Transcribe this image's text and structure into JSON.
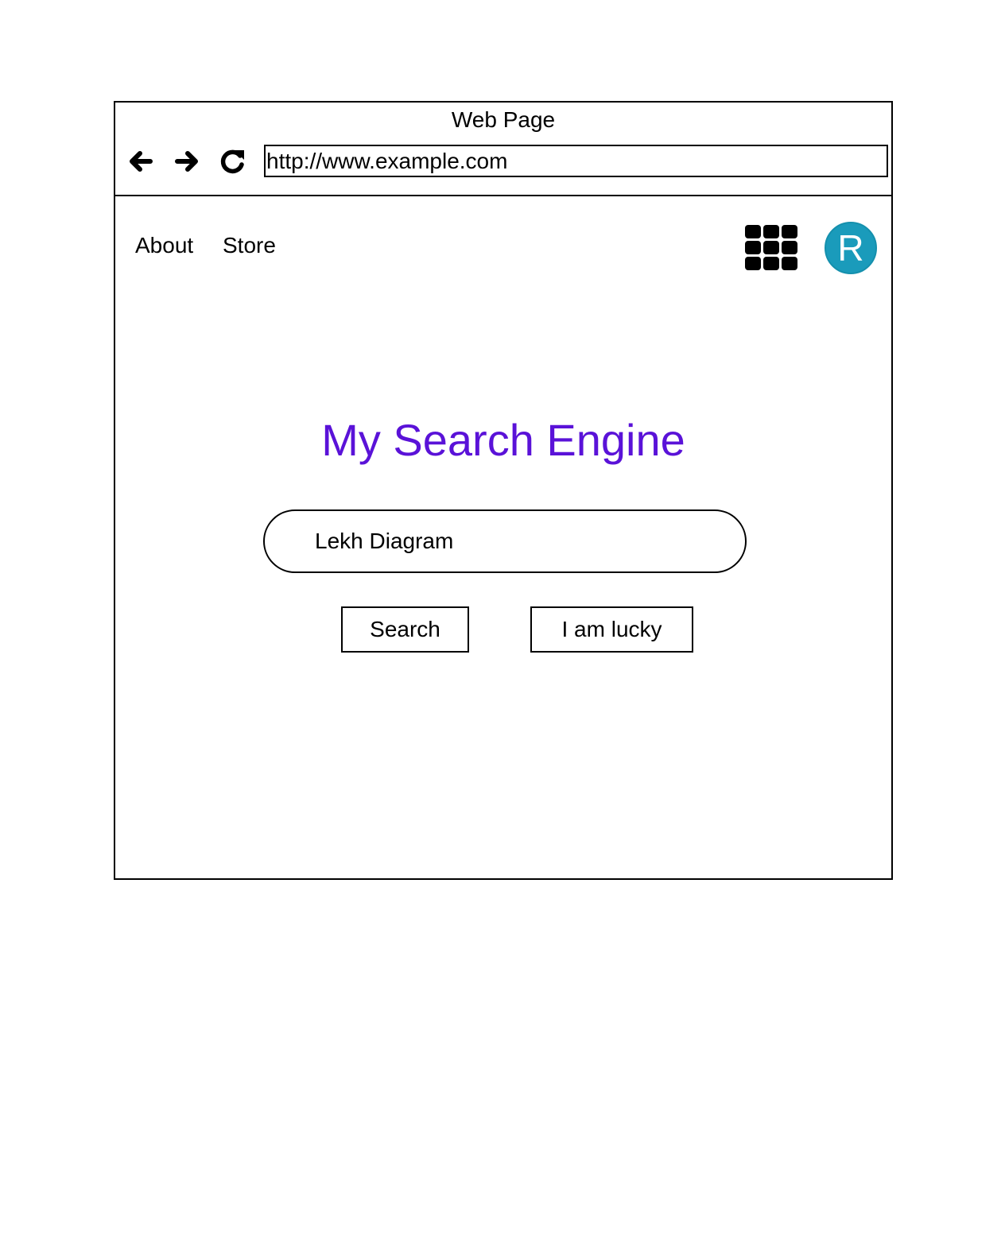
{
  "window": {
    "title": "Web Page",
    "url": "http://www.example.com"
  },
  "toolbar": {
    "back_icon": "arrow-left-icon",
    "forward_icon": "arrow-right-icon",
    "reload_icon": "reload-icon"
  },
  "nav": {
    "links": [
      {
        "label": "About"
      },
      {
        "label": "Store"
      }
    ],
    "apps_icon": "grid-icon",
    "avatar_letter": "R",
    "avatar_color": "#1a9bbb"
  },
  "main": {
    "brand": "My Search Engine",
    "brand_color": "#5a12d8",
    "search_value": "Lekh Diagram",
    "search_button": "Search",
    "lucky_button": "I am lucky"
  }
}
